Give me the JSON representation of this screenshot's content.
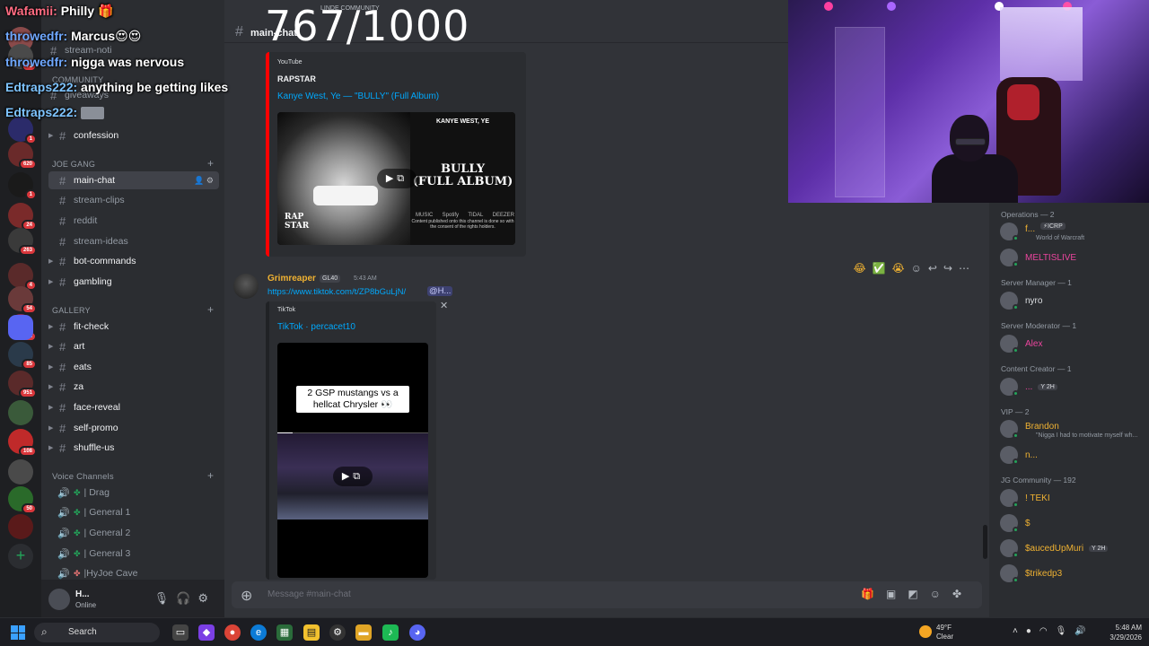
{
  "overlay_chat": [
    {
      "user": "Wafamii:",
      "text": "Philly"
    },
    {
      "user": "throwedfr:",
      "text": "Marcus😍😍"
    },
    {
      "user": "throwedfr:",
      "text": "nigga was nervous"
    },
    {
      "user": "Edtraps222:",
      "text": "anything be getting likes"
    },
    {
      "user": "Edtraps222:",
      "text": ""
    }
  ],
  "counter": {
    "value": "767/1000",
    "subtitle": "LINDE COMMUNITY"
  },
  "servers": {
    "badges": [
      "71",
      "1",
      "620",
      "1",
      "24",
      "263",
      "4",
      "54",
      "71",
      "85",
      "951",
      "108",
      "50"
    ],
    "add_label": "+"
  },
  "sidebar": {
    "top_channels": [
      "stream-noti",
      "giveaways"
    ],
    "community_label": "Community",
    "confession": "confession",
    "cat_joe_gang": "JOE GANG",
    "joe_gang": [
      "main-chat",
      "stream-clips",
      "reddit",
      "stream-ideas",
      "bot-commands",
      "gambling"
    ],
    "cat_gallery": "GALLERY",
    "gallery": [
      "fit-check",
      "art",
      "eats",
      "za",
      "face-reveal",
      "self-promo",
      "shuffle-us"
    ],
    "cat_voice": "Voice Channels",
    "voice": [
      "| Drag",
      "| General 1",
      "| General 2",
      "| General 3",
      "|HyJoe Cave"
    ],
    "user": {
      "name": "H...",
      "status": "Online"
    }
  },
  "main": {
    "channel": "main-chat",
    "yt_embed": {
      "provider": "YouTube",
      "author": "RAPSTAR",
      "title": "Kanye West, Ye — \"BULLY\" (Full Album)",
      "thumb_artist": "KANYE WEST, YE",
      "thumb_title_1": "BULLY",
      "thumb_title_2": "(FULL ALBUM)",
      "thumb_logo": "RAP STAR",
      "thumb_platforms": [
        "MUSIC",
        "Spotify",
        "TIDAL",
        "DEEZER"
      ],
      "thumb_note": "Content published onto this channel is done so with the consent of the rights holders."
    },
    "message": {
      "user": "Grimreaper",
      "tag": "GL40",
      "time": "5:43 AM",
      "link": "https://www.tiktok.com/t/ZP8bGuLjN/",
      "mention": "@H..."
    },
    "tt_embed": {
      "provider": "TikTok",
      "title": "TikTok · percacet10",
      "caption": "2 GSP mustangs vs a hellcat Chrysler 👀"
    },
    "composer_placeholder": "Message #main-chat"
  },
  "members": {
    "groups": [
      {
        "header": "Operations — 2",
        "rows": [
          {
            "name": "f...",
            "tag": "⚡ICRP",
            "sub": "World of Warcraft",
            "color": "#f0b232"
          },
          {
            "name": "MELTISLIVE",
            "tag": "",
            "sub": "",
            "color": "#eb459e"
          }
        ]
      },
      {
        "header": "Server Manager — 1",
        "rows": [
          {
            "name": "nyro",
            "tag": "",
            "sub": "",
            "color": "#dbdee1"
          }
        ]
      },
      {
        "header": "Server Moderator — 1",
        "rows": [
          {
            "name": "Alex",
            "tag": "",
            "sub": "",
            "color": "#eb459e"
          }
        ]
      },
      {
        "header": "Content Creator — 1",
        "rows": [
          {
            "name": "...",
            "tag": "Y 2H",
            "sub": "",
            "color": "#eb459e"
          }
        ]
      },
      {
        "header": "VIP — 2",
        "rows": [
          {
            "name": "Brandon",
            "tag": "",
            "sub": "\"Nigga I had to motivate myself wh...",
            "color": "#f0b232"
          },
          {
            "name": "n...",
            "tag": "",
            "sub": "",
            "color": "#f0b232"
          }
        ]
      },
      {
        "header": "JG Community — 192",
        "rows": [
          {
            "name": "! TEKI",
            "tag": "",
            "sub": "",
            "color": "#f0b232"
          },
          {
            "name": "$",
            "tag": "",
            "sub": "",
            "color": "#f0b232"
          },
          {
            "name": "$aucedUpMuri",
            "tag": "Y 2H",
            "sub": "",
            "color": "#f0b232"
          },
          {
            "name": "$trikedp3",
            "tag": "",
            "sub": "",
            "color": "#f0b232"
          }
        ]
      }
    ]
  },
  "taskbar": {
    "search": "Search",
    "weather_temp": "49°F",
    "weather_cond": "Clear",
    "time": "5:48 AM",
    "date": "3/29/2026"
  },
  "colors": {
    "accent": "#5865f2",
    "link": "#00a8fc",
    "embed_bar": "#ff0000",
    "online": "#23a55a"
  }
}
